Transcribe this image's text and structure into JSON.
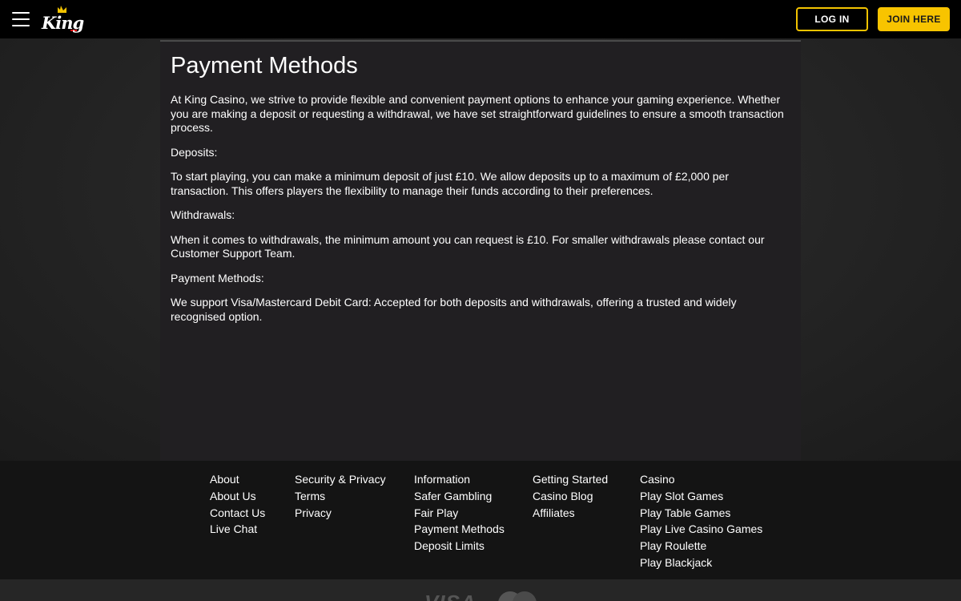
{
  "header": {
    "logo_text": "King",
    "login_label": "LOG IN",
    "join_label": "JOIN HERE"
  },
  "page": {
    "title": "Payment Methods",
    "paragraphs": [
      "At King Casino, we strive to provide flexible and convenient payment options to enhance your gaming experience. Whether you are making a deposit or requesting a withdrawal, we have set straightforward guidelines to ensure a smooth transaction process.",
      "Deposits:",
      "To start playing, you can make a minimum deposit of just £10. We allow deposits up to a maximum of £2,000 per transaction. This offers players the flexibility to manage their funds according to their preferences.",
      "Withdrawals:",
      "When it comes to withdrawals, the minimum amount you can request is £10. For smaller withdrawals please contact our Customer Support Team.",
      "Payment Methods:",
      "We support Visa/Mastercard Debit Card: Accepted for both deposits and withdrawals, offering a trusted and widely recognised option."
    ]
  },
  "footer": {
    "columns": [
      {
        "heading": "About",
        "links": [
          "About Us",
          "Contact Us",
          "Live Chat"
        ]
      },
      {
        "heading": "Security & Privacy",
        "links": [
          "Terms",
          "Privacy"
        ]
      },
      {
        "heading": "Information",
        "links": [
          "Safer Gambling",
          "Fair Play",
          "Payment Methods",
          "Deposit Limits"
        ]
      },
      {
        "heading": "Getting Started",
        "links": [
          "Casino Blog",
          "Affiliates"
        ]
      },
      {
        "heading": "Casino",
        "links": [
          "Play Slot Games",
          "Play Table Games",
          "Play Live Casino Games",
          "Play Roulette",
          "Play Blackjack"
        ]
      }
    ],
    "payment_logos": {
      "visa_text": "VISA"
    }
  },
  "colors": {
    "accent": "#f8c400",
    "background": "#141414",
    "card": "#211f22"
  },
  "icons": [
    "hamburger-menu-icon",
    "king-casino-logo",
    "mastercard-logo"
  ]
}
